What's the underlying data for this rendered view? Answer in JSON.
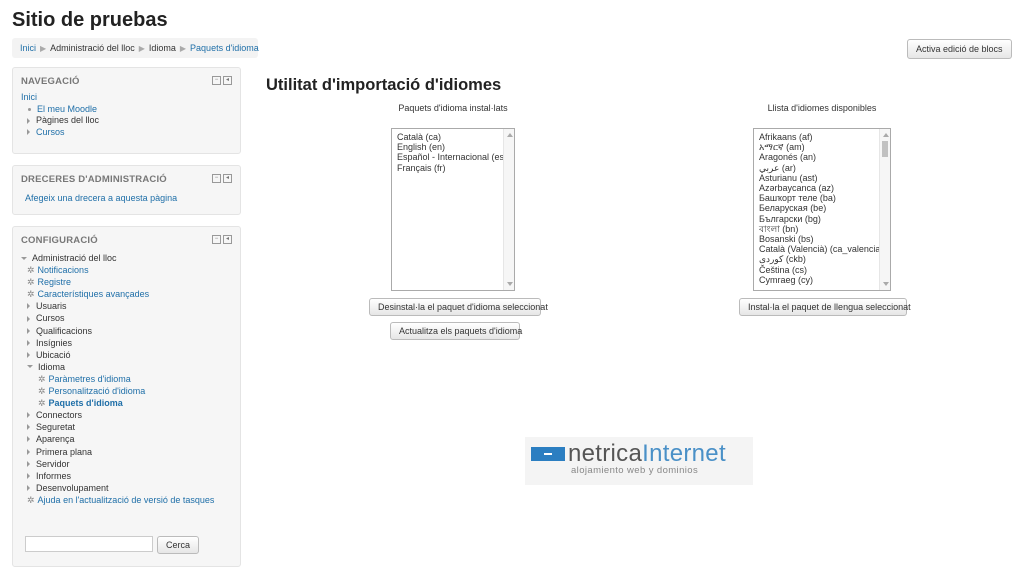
{
  "site_title": "Sitio de pruebas",
  "breadcrumb": [
    "Inici",
    "Administració del lloc",
    "Idioma",
    "Paquets d'idioma"
  ],
  "edit_blocks_button": "Activa edició de blocs",
  "blocks": {
    "navegacio": {
      "title": "NAVEGACIÓ",
      "items": [
        "Inici",
        "El meu Moodle",
        "Pàgines del lloc",
        "Cursos"
      ]
    },
    "dreceres": {
      "title": "DRECERES D'ADMINISTRACIÓ",
      "link": "Afegeix una drecera a aquesta pàgina"
    },
    "configuracio": {
      "title": "CONFIGURACIÓ",
      "root": "Administració del lloc",
      "items": [
        "Notificacions",
        "Registre",
        "Característiques avançades",
        "Usuaris",
        "Cursos",
        "Qualificacions",
        "Insígnies",
        "Ubicació",
        "Idioma",
        "Paràmetres d'idioma",
        "Personalització d'idioma",
        "Paquets d'idioma",
        "Connectors",
        "Seguretat",
        "Aparença",
        "Primera plana",
        "Servidor",
        "Informes",
        "Desenvolupament",
        "Ajuda en l'actualització de versió de tasques"
      ],
      "search_button": "Cerca"
    }
  },
  "main": {
    "title": "Utilitat d'importació d'idiomes",
    "installed_heading": "Paquets d'idioma instal·lats",
    "available_heading": "Llista d'idiomes disponibles",
    "installed": [
      "Català (ca)",
      "English (en)",
      "Español - Internacional (es)",
      "Français (fr)"
    ],
    "available": [
      "Afrikaans (af)",
      "አማርኛ (am)",
      "Aragonés (an)",
      "عربي (ar)",
      "Asturianu (ast)",
      "Azərbaycanca (az)",
      "Башҡорт теле (ba)",
      "Беларуская (be)",
      "Български (bg)",
      "বাংলা (bn)",
      "Bosanski (bs)",
      "Català (Valencià) (ca_valencia)",
      "کوردی (ckb)",
      "Čeština (cs)",
      "Cymraeg (cy)"
    ],
    "uninstall_button": "Desinstal·la el paquet d'idioma seleccionat",
    "update_button": "Actualitza els paquets d'idioma",
    "install_button": "Instal·la el paquet de llengua seleccionat"
  },
  "logo": {
    "word1": "netrica",
    "word2": "Internet",
    "tagline": "alojamiento web y dominios"
  },
  "colors": {
    "link": "#1f6fa8",
    "logo_blue": "#2b7ec1"
  }
}
